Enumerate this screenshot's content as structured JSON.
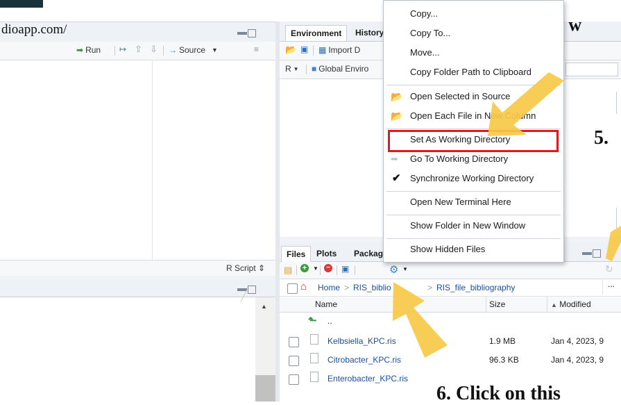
{
  "browser": {
    "url_fragment": "dioapp.com/"
  },
  "source_pane": {
    "toolbar": {
      "run_label": "Run",
      "source_label": "Source"
    },
    "footer": {
      "script_type": "R Script"
    }
  },
  "environment_pane": {
    "tabs": [
      "Environment",
      "History"
    ],
    "toolbar": {
      "import_label": "Import D",
      "lang_label": "R",
      "scope_label": "Global Enviro"
    }
  },
  "files_pane": {
    "tabs": [
      "Files",
      "Plots",
      "Packag"
    ],
    "breadcrumb": [
      "Home",
      "RIS_biblio",
      "RIS_file_bibliography"
    ],
    "columns": {
      "name": "Name",
      "size": "Size",
      "modified": "Modified"
    },
    "parent": "..",
    "files": [
      {
        "name": "Kelbsiella_KPC.ris",
        "size": "1.9 MB",
        "modified": "Jan 4, 2023, 9"
      },
      {
        "name": "Citrobacter_KPC.ris",
        "size": "96.3 KB",
        "modified": "Jan 4, 2023, 9"
      },
      {
        "name": "Enterobacter_KPC.ris",
        "size": "",
        "modified": ""
      }
    ],
    "more_label": "..."
  },
  "context_menu": {
    "items": [
      {
        "label": "Copy..."
      },
      {
        "label": "Copy To..."
      },
      {
        "label": "Move..."
      },
      {
        "label": "Copy Folder Path to Clipboard"
      },
      {
        "label": "Open Selected in Source"
      },
      {
        "label": "Open Each File in New Column"
      },
      {
        "label": "Set As Working Directory"
      },
      {
        "label": "Go To Working Directory"
      },
      {
        "label": "Synchronize Working Directory"
      },
      {
        "label": "Open New Terminal Here"
      },
      {
        "label": "Show Folder in New Window"
      },
      {
        "label": "Show Hidden Files"
      }
    ]
  },
  "annotations": {
    "top_text": "“set as w",
    "step5": "5.",
    "step6": "6. Click on this",
    "highlight_color": "#e8161b",
    "arrow_color": "#f7c948"
  }
}
